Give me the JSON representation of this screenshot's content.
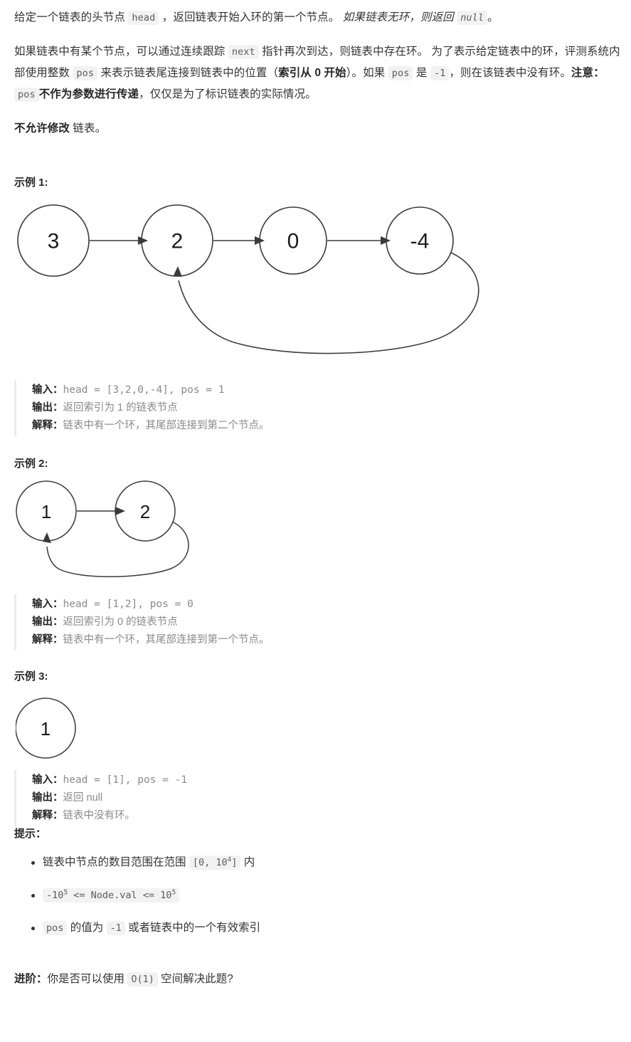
{
  "description": {
    "p1": {
      "seg1": "给定一个链表的头节点 ",
      "code1": "head",
      "seg2": " ，返回链表开始入环的第一个节点。 ",
      "italic": "如果链表无环，则返回 ",
      "italic_code": "null",
      "seg3": "。"
    },
    "p2": {
      "seg1": "如果链表中有某个节点，可以通过连续跟踪 ",
      "code1": "next",
      "seg2": " 指针再次到达，则链表中存在环。 为了表示给定链表中的环，评测系统内部使用整数 ",
      "code2": "pos",
      "seg3": " 来表示链表尾连接到链表中的位置（",
      "bold1": "索引从 0 开始",
      "seg4": "）。如果 ",
      "code3": "pos",
      "seg5": " 是 ",
      "code4": "-1",
      "seg6": "，则在该链表中没有环。",
      "bold2": "注意：",
      "code5": "pos",
      "bold3": "不作为参数进行传递",
      "seg7": "，仅仅是为了标识链表的实际情况。"
    },
    "p3": {
      "bold": "不允许修改",
      "text": " 链表。"
    }
  },
  "examples": [
    {
      "title": "示例 1:",
      "diagram": {
        "nodes": [
          "3",
          "2",
          "0",
          "-4"
        ],
        "cycle_target_index": 1
      },
      "input_label": "输入：",
      "input_value": "head = [3,2,0,-4], pos = 1",
      "output_label": "输出：",
      "output_value": "返回索引为 1 的链表节点",
      "explain_label": "解释：",
      "explain_value": "链表中有一个环，其尾部连接到第二个节点。"
    },
    {
      "title": "示例 2:",
      "diagram": {
        "nodes": [
          "1",
          "2"
        ],
        "cycle_target_index": 0
      },
      "input_label": "输入：",
      "input_value": "head = [1,2], pos = 0",
      "output_label": "输出：",
      "output_value": "返回索引为 0 的链表节点",
      "explain_label": "解释：",
      "explain_value": "链表中有一个环，其尾部连接到第一个节点。"
    },
    {
      "title": "示例 3:",
      "diagram": {
        "nodes": [
          "1"
        ],
        "cycle_target_index": -1
      },
      "input_label": "输入：",
      "input_value": "head = [1], pos = -1",
      "output_label": "输出：",
      "output_value": "返回 null",
      "explain_label": "解释：",
      "explain_value": "链表中没有环。"
    }
  ],
  "hints": {
    "title": "提示：",
    "items": [
      {
        "pre": "链表中节点的数目范围在范围 ",
        "code_prefix": "[0, 10",
        "code_sup": "4",
        "code_suffix": "]",
        "post": " 内"
      },
      {
        "pre": "",
        "code_prefix": "-10",
        "code_sup": "5",
        "code_suffix": " <= Node.val <= 10",
        "code_sup2": "5",
        "post": ""
      },
      {
        "pre": "",
        "code_a": "pos",
        "mid": " 的值为 ",
        "code_b": "-1",
        "post": " 或者链表中的一个有效索引"
      }
    ]
  },
  "followup": {
    "label": "进阶：",
    "text1": "你是否可以使用 ",
    "code": "O(1)",
    "text2": " 空间解决此题?"
  },
  "colors": {
    "text": "#333333",
    "code_bg": "#f2f2f2",
    "code_fg": "#5c5c5c",
    "quote_border": "#ececec",
    "quote_value": "#8a8a8a",
    "diagram_stroke": "#3a3a3a"
  }
}
